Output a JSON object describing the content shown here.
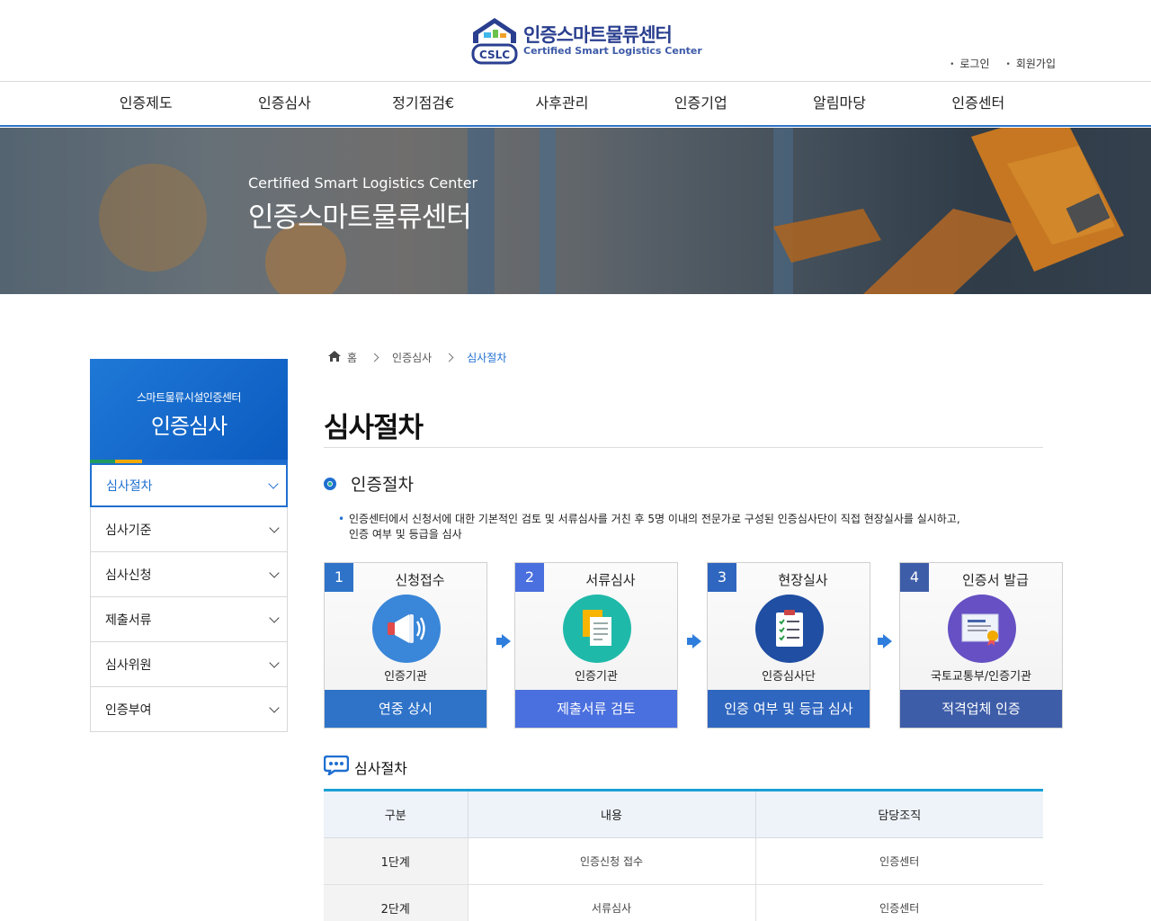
{
  "header": {
    "logo_ko": "인증스마트물류센터",
    "logo_en": "Certified Smart Logistics Center",
    "logo_badge": "CSLC",
    "util_links": [
      "로그인",
      "회원가입"
    ]
  },
  "gnb": {
    "items": [
      "인증제도",
      "인증심사",
      "정기점검€",
      "사후관리",
      "인증기업",
      "알림마당",
      "인증센터"
    ]
  },
  "banner": {
    "title_en": "Certified Smart Logistics Center",
    "title_ko": "인증스마트물류센터"
  },
  "sidebar": {
    "sub_title": "스마트물류시설인증센터",
    "main_title": "인증심사",
    "items": [
      {
        "label": "심사절차",
        "active": true
      },
      {
        "label": "심사기준",
        "active": false
      },
      {
        "label": "심사신청",
        "active": false
      },
      {
        "label": "제출서류",
        "active": false
      },
      {
        "label": "심사위원",
        "active": false
      },
      {
        "label": "인증부여",
        "active": false
      }
    ]
  },
  "breadcrumb": [
    "홈",
    "인증심사",
    "심사절차"
  ],
  "page_title": "심사절차",
  "section": {
    "title": "인증절차",
    "description_line1": "인증센터에서 신청서에 대한 기본적인 검토 및 서류심사를 거친 후 5명 이내의 전문가로 구성된 인증심사단이 직접 현장실사를 실시하고,",
    "description_line2": "인증 여부 및 등급을 심사"
  },
  "steps": [
    {
      "num": "1",
      "name": "신청접수",
      "org": "인증기관",
      "action": "연중 상시",
      "icon": "megaphone-icon",
      "color": "#2f73c9",
      "circle": "#3a86d8"
    },
    {
      "num": "2",
      "name": "서류심사",
      "org": "인증기관",
      "action": "제출서류 검토",
      "icon": "documents-icon",
      "color": "#4a6fde",
      "circle": "#1fb9a9"
    },
    {
      "num": "3",
      "name": "현장실사",
      "org": "인증심사단",
      "action": "인증 여부 및 등급 심사",
      "icon": "checklist-icon",
      "color": "#2f66bf",
      "circle": "#1f4ea3"
    },
    {
      "num": "4",
      "name": "인증서 발급",
      "org": "국토교통부/인증기관",
      "action": "적격업체 인증",
      "icon": "certificate-icon",
      "color": "#3e5da8",
      "circle": "#6650c4"
    }
  ],
  "process": {
    "title": "심사절차",
    "headers": [
      "구분",
      "내용",
      "담당조직"
    ],
    "rows": [
      [
        "1단계",
        "인증신청 접수",
        "인증센터"
      ],
      [
        "2단계",
        "서류심사",
        "인증센터"
      ]
    ]
  }
}
